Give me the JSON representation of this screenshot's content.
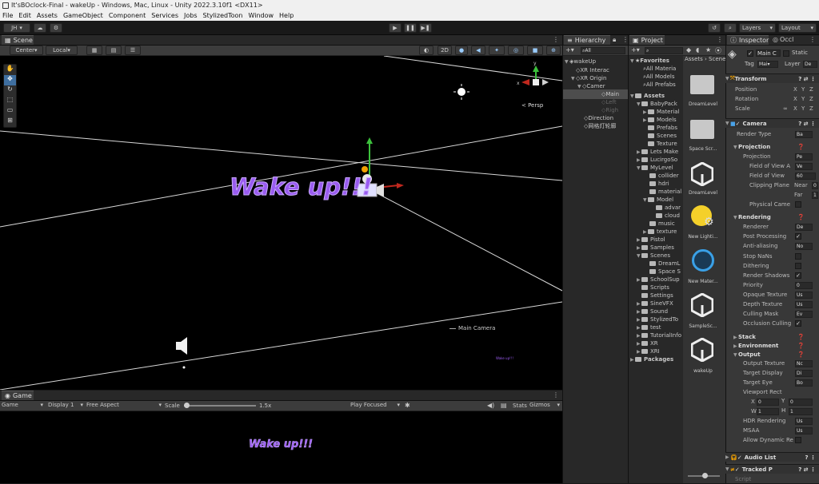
{
  "window": {
    "title": "It'sBOclock-Final - wakeUp - Windows, Mac, Linux - Unity 2022.3.10f1 <DX11>"
  },
  "menu": [
    "File",
    "Edit",
    "Assets",
    "GameObject",
    "Component",
    "Services",
    "Jobs",
    "StylizedToon",
    "Window",
    "Help"
  ],
  "toolbar": {
    "account": "JH",
    "layers": "Layers",
    "layout": "Layout"
  },
  "scene": {
    "tab": "Scene",
    "pivot": "Center",
    "space": "Local",
    "mode_2d": "2D",
    "persp": "< Persp",
    "wake_text": "Wake up!!!",
    "camera_label": "Main Camera",
    "tiny_text": "Wake up!!!"
  },
  "game": {
    "tab": "Game",
    "display_mode": "Game",
    "display": "Display 1",
    "aspect": "Free Aspect",
    "scale_label": "Scale",
    "scale_value": "1.5x",
    "play_mode": "Play Focused",
    "stats": "Stats",
    "gizmos": "Gizmos",
    "wake_text": "Wake up!!!"
  },
  "hierarchy": {
    "tab": "Hierarchy",
    "search": "All",
    "items": [
      {
        "label": "wakeUp"
      },
      {
        "label": "XR Interac"
      },
      {
        "label": "XR Origin"
      },
      {
        "label": "Camer"
      },
      {
        "label": "Main"
      },
      {
        "label": "Left"
      },
      {
        "label": "Righ"
      },
      {
        "label": "Direction"
      },
      {
        "label": "网格灯轮廓"
      }
    ]
  },
  "project": {
    "tab": "Project",
    "search": "",
    "breadcrumb": "Assets › Scene",
    "favorites_title": "Favorites",
    "favorites": [
      "All Materia",
      "All Models",
      "All Prefabs"
    ],
    "assets_title": "Assets",
    "tree": [
      "BabyPack",
      "Material",
      "Models",
      "Prefabs",
      "Scenes",
      "Texture",
      "Lets Make",
      "LucirgoSo",
      "MyLevel",
      "collider",
      "hdri",
      "material",
      "Model",
      "advar",
      "cloud",
      "music",
      "texture",
      "Pistol",
      "Samples",
      "Scenes",
      "DreamL",
      "Space S",
      "SchoolSup",
      "Scripts",
      "Settings",
      "SineVFX",
      "Sound",
      "StylizedTo",
      "test",
      "TutorialInfo",
      "XR",
      "XRI"
    ],
    "packages_title": "Packages",
    "grid": [
      {
        "label": "DreamLevel",
        "icon": "folder"
      },
      {
        "label": "Space Scr...",
        "icon": "folder"
      },
      {
        "label": "DreamLevel",
        "icon": "unity"
      },
      {
        "label": "New Lighti...",
        "icon": "lighting"
      },
      {
        "label": "New Mater...",
        "icon": "material"
      },
      {
        "label": "SampleSc...",
        "icon": "unity"
      },
      {
        "label": "wakeUp",
        "icon": "unity"
      }
    ]
  },
  "inspector": {
    "tab": "Inspector",
    "tab2": "Occl",
    "object_name": "Main C",
    "static_label": "Static",
    "tag_label": "Tag",
    "tag_value": "Mai",
    "layer_label": "Layer",
    "layer_value": "De",
    "transform": {
      "title": "Transform",
      "rows": [
        "Position",
        "Rotation",
        "Scale"
      ],
      "axes": [
        "X",
        "Y",
        "Z"
      ]
    },
    "camera": {
      "title": "Camera",
      "render_type_label": "Render Type",
      "render_type": "Ba",
      "projection_title": "Projection",
      "projection_label": "Projection",
      "projection_value": "Pe",
      "fov_axis_label": "Field of View A",
      "fov_axis_value": "Ve",
      "fov_label": "Field of View",
      "fov_value": "60",
      "clipping_label": "Clipping Plane",
      "near_label": "Near",
      "near_value": "0",
      "far_label": "Far",
      "far_value": "1",
      "physical_label": "Physical Came",
      "rendering_title": "Rendering",
      "renderer_label": "Renderer",
      "renderer_value": "De",
      "post_label": "Post Processing",
      "aa_label": "Anti-aliasing",
      "aa_value": "No",
      "stopnan_label": "Stop NaNs",
      "dither_label": "Dithering",
      "shadows_label": "Render Shadows",
      "priority_label": "Priority",
      "priority_value": "0",
      "opaque_label": "Opaque Texture",
      "opaque_value": "Us",
      "depth_label": "Depth Texture",
      "depth_value": "Us",
      "cull_label": "Culling Mask",
      "cull_value": "Ev",
      "occl_label": "Occlusion Culling",
      "stack_title": "Stack",
      "env_title": "Environment",
      "output_title": "Output",
      "outtex_label": "Output Texture",
      "outtex_value": "Nc",
      "tdisp_label": "Target Display",
      "tdisp_value": "Di",
      "teye_label": "Target Eye",
      "teye_value": "Bo",
      "viewport_label": "Viewport Rect",
      "vx_label": "X",
      "vx_value": "0",
      "vy_label": "Y",
      "vy_value": "0",
      "vw_label": "W",
      "vw_value": "1",
      "vh_label": "H",
      "vh_value": "1",
      "hdr_label": "HDR Rendering",
      "hdr_value": "Us",
      "msaa_label": "MSAA",
      "msaa_value": "Us",
      "dyn_label": "Allow Dynamic Re"
    },
    "audio_title": "Audio List",
    "tracked_title": "Tracked P",
    "script_label": "Script"
  },
  "colors": {
    "accent": "#3a72b0",
    "wake": "#9a5cf0",
    "selection": "#2c5d87"
  }
}
